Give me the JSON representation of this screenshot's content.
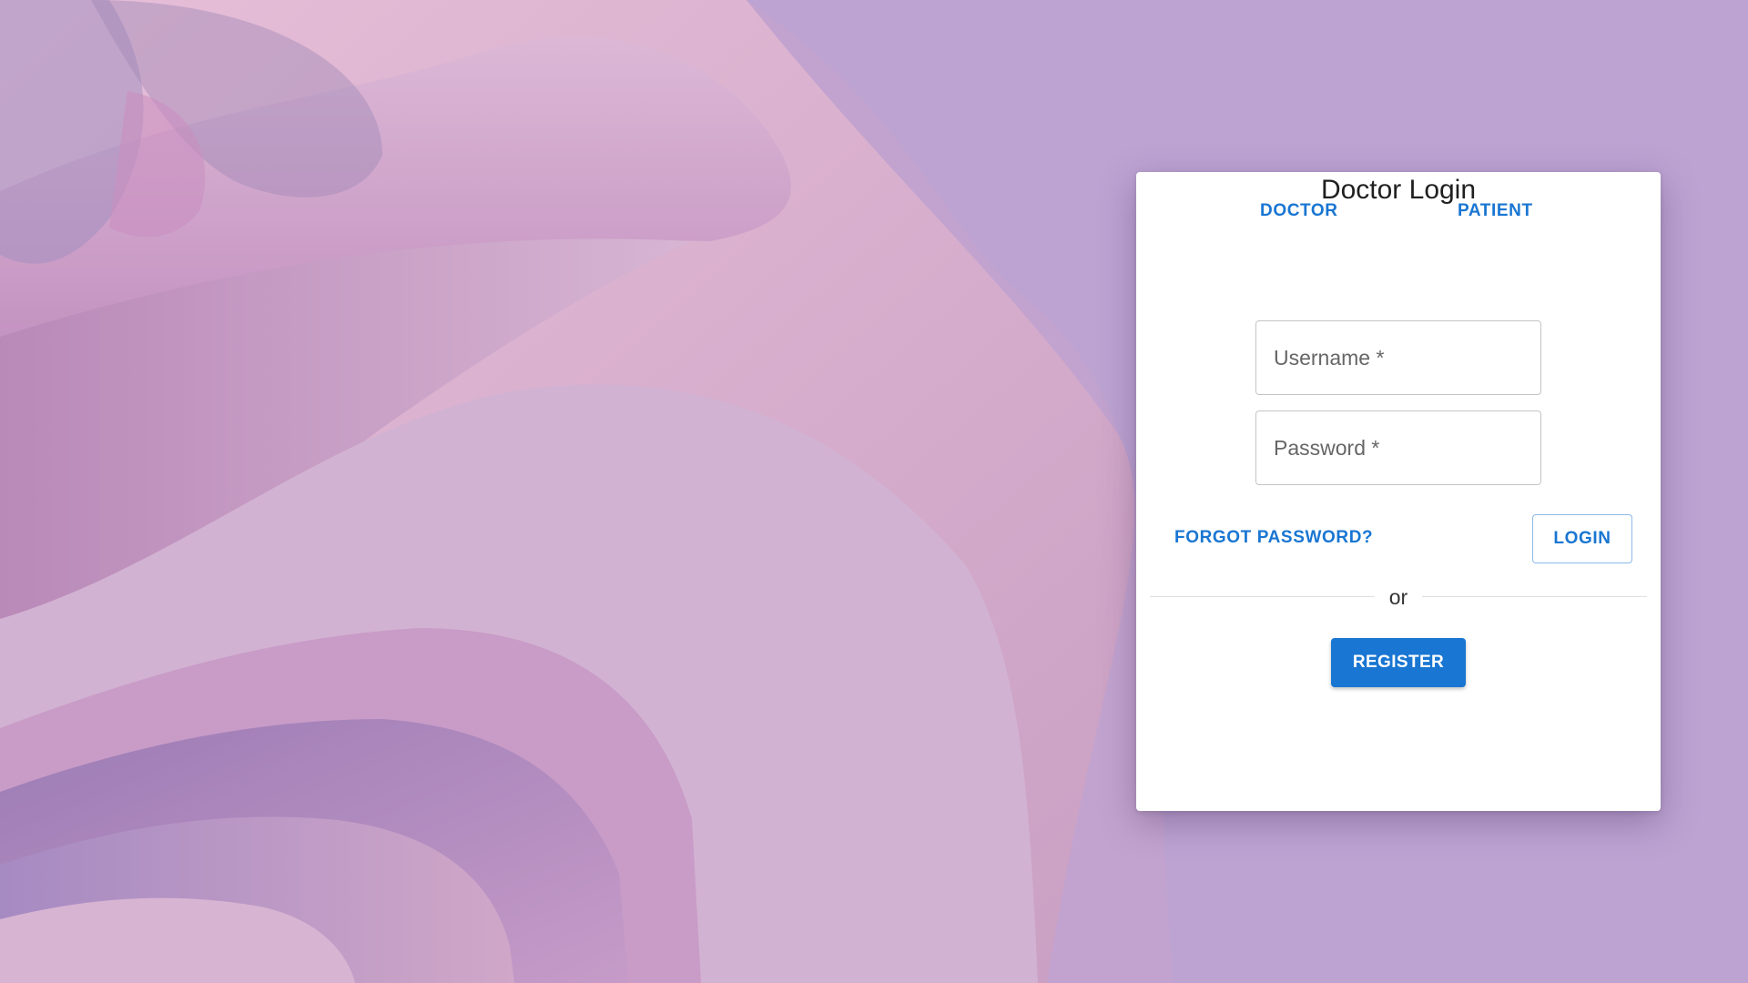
{
  "tabs": {
    "doctor_label": "DOCTOR",
    "patient_label": "PATIENT"
  },
  "login": {
    "title": "Doctor Login",
    "username_placeholder": "Username *",
    "password_placeholder": "Password *",
    "username_value": "",
    "password_value": "",
    "forgot_label": "FORGOT PASSWORD?",
    "login_label": "LOGIN",
    "divider_text": "or",
    "register_label": "REGISTER"
  },
  "colors": {
    "accent": "#1976d2",
    "card_background": "#ffffff",
    "wallpaper_pink": "#d8aacb",
    "wallpaper_lavender": "#b3a0d4"
  },
  "icons": {
    "wallpaper": "abstract-pink-waves"
  }
}
